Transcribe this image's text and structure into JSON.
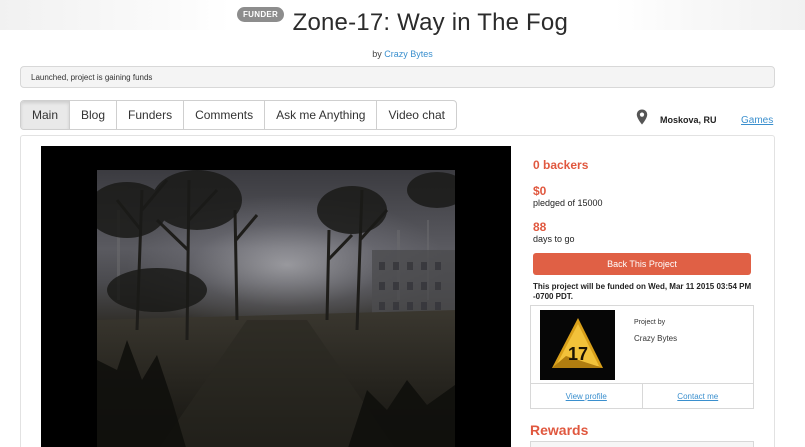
{
  "header": {
    "badge": "FUNDER",
    "title": "Zone-17: Way in The Fog",
    "by_prefix": "by",
    "author": "Crazy Bytes"
  },
  "status": {
    "text": "Launched, project is gaining funds"
  },
  "tabs": [
    {
      "label": "Main",
      "active": true
    },
    {
      "label": "Blog",
      "active": false
    },
    {
      "label": "Funders",
      "active": false
    },
    {
      "label": "Comments",
      "active": false
    },
    {
      "label": "Ask me Anything",
      "active": false
    },
    {
      "label": "Video chat",
      "active": false
    }
  ],
  "meta": {
    "location": "Moskova, RU",
    "location_icon": "map-pin-icon",
    "category": "Games"
  },
  "stats": {
    "backers": "0 backers",
    "pledged_value": "$0",
    "pledged_label": "pledged of 15000",
    "days_value": "88",
    "days_label": "days to go"
  },
  "actions": {
    "back_button": "Back This Project",
    "funding_note": "This project will be funded on Wed, Mar 11 2015 03:54 PM -0700 PDT."
  },
  "creator": {
    "project_by_label": "Project by",
    "name": "Crazy Bytes",
    "view_profile": "View profile",
    "contact_me": "Contact me"
  },
  "rewards": {
    "heading": "Rewards"
  },
  "colors": {
    "accent": "#e0583f",
    "link": "#3a8fce",
    "badge": "#8d8d8d"
  }
}
